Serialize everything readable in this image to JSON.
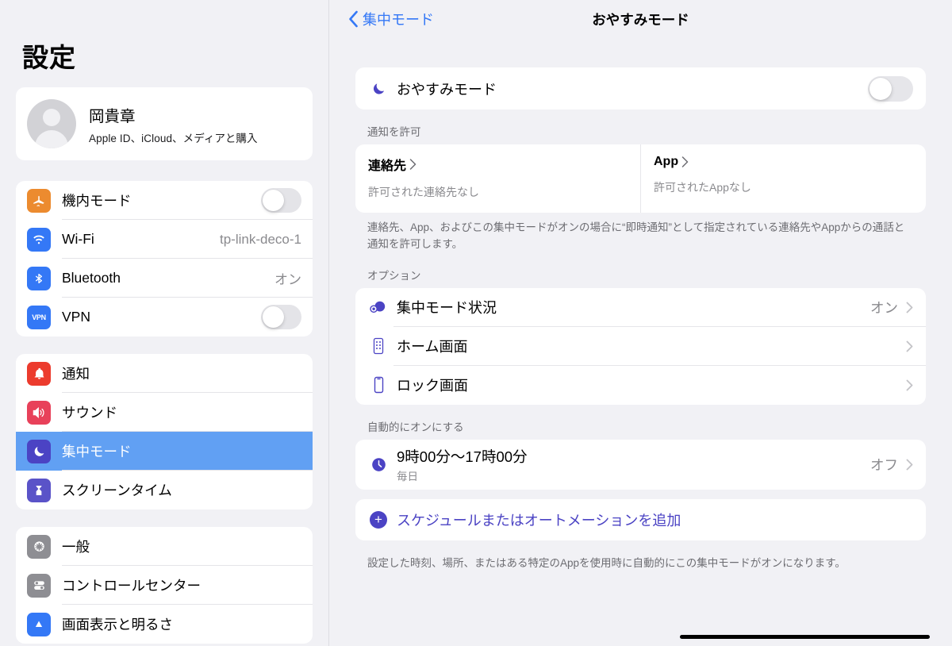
{
  "sidebar": {
    "title": "設定",
    "account": {
      "name": "岡貴章",
      "subtitle": "Apple ID、iCloud、メディアと購入",
      "avatar_icon": "person-avatar-icon"
    },
    "groups": [
      {
        "items": [
          {
            "label": "機内モード",
            "icon": "airplane-icon",
            "icon_color": "#ec8b2f",
            "control": "toggle",
            "toggle_on": false
          },
          {
            "label": "Wi-Fi",
            "icon": "wifi-icon",
            "icon_color": "#3478f6",
            "value": "tp-link-deco-1"
          },
          {
            "label": "Bluetooth",
            "icon": "bluetooth-icon",
            "icon_color": "#3478f6",
            "value": "オン"
          },
          {
            "label": "VPN",
            "icon": "vpn-icon",
            "icon_color": "#3478f6",
            "control": "toggle",
            "toggle_on": false
          }
        ]
      },
      {
        "items": [
          {
            "label": "通知",
            "icon": "bell-icon",
            "icon_color": "#ec3b2d"
          },
          {
            "label": "サウンド",
            "icon": "speaker-icon",
            "icon_color": "#e8415a"
          },
          {
            "label": "集中モード",
            "icon": "moon-icon",
            "icon_color": "#4b43c4",
            "selected": true
          },
          {
            "label": "スクリーンタイム",
            "icon": "hourglass-icon",
            "icon_color": "#5a53c8"
          }
        ]
      },
      {
        "items": [
          {
            "label": "一般",
            "icon": "gear-icon",
            "icon_color": "#8e8e93"
          },
          {
            "label": "コントロールセンター",
            "icon": "control-center-icon",
            "icon_color": "#8e8e93"
          },
          {
            "label": "画面表示と明るさ",
            "icon": "display-brightness-icon",
            "icon_color": "#3478f6"
          }
        ]
      }
    ]
  },
  "detail": {
    "back_label": "集中モード",
    "title": "おやすみモード",
    "main_toggle": {
      "label": "おやすみモード",
      "icon": "moon-icon",
      "on": false
    },
    "allow_notifications": {
      "header": "通知を許可",
      "columns": [
        {
          "title": "連絡先",
          "subtitle": "許可された連絡先なし"
        },
        {
          "title": "App",
          "subtitle": "許可されたAppなし"
        }
      ],
      "footnote": "連絡先、App、およびこの集中モードがオンの場合に“即時通知”として指定されている連絡先やAppからの通話と通知を許可します。"
    },
    "options": {
      "header": "オプション",
      "rows": [
        {
          "label": "集中モード状況",
          "icon": "focus-status-icon",
          "value": "オン"
        },
        {
          "label": "ホーム画面",
          "icon": "home-screen-icon",
          "value": ""
        },
        {
          "label": "ロック画面",
          "icon": "lock-screen-icon",
          "value": ""
        }
      ]
    },
    "automation": {
      "header": "自動的にオンにする",
      "schedule": {
        "icon": "clock-icon",
        "time": "9時00分〜17時00分",
        "repeat": "毎日",
        "value": "オフ"
      },
      "add_label": "スケジュールまたはオートメーションを追加",
      "add_icon": "plus-circle-icon",
      "footnote": "設定した時刻、場所、またはある特定のAppを使用時に自動的にこの集中モードがオンになります。"
    }
  },
  "colors": {
    "accent_blue": "#3478f6",
    "selection_blue": "#61a0f3",
    "indigo": "#4b43c4",
    "background": "#f1f1f5"
  }
}
